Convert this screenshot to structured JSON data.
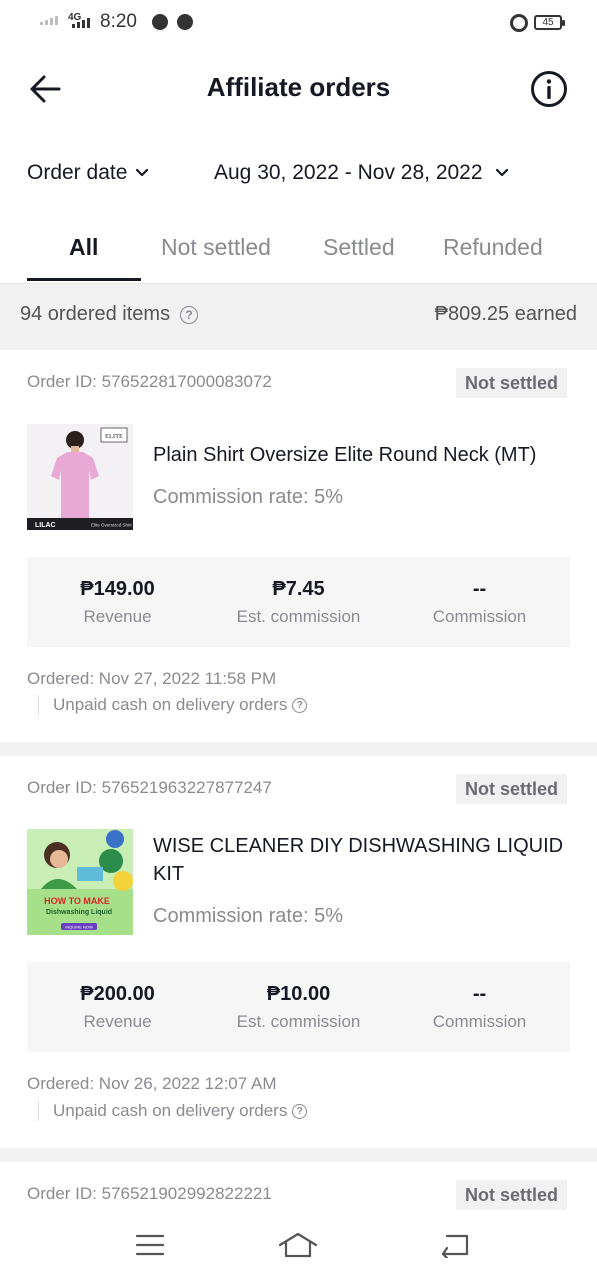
{
  "status_bar": {
    "network": "4G",
    "time": "8:20",
    "battery": "45"
  },
  "header": {
    "title": "Affiliate orders"
  },
  "filters": {
    "order_date_label": "Order date",
    "date_range": "Aug 30, 2022 - Nov 28, 2022"
  },
  "tabs": [
    {
      "label": "All",
      "active": true
    },
    {
      "label": "Not settled",
      "active": false
    },
    {
      "label": "Settled",
      "active": false
    },
    {
      "label": "Refunded",
      "active": false
    }
  ],
  "summary": {
    "ordered_items": "94 ordered items",
    "earned": "₱809.25 earned"
  },
  "orders": [
    {
      "order_id": "Order ID: 576522817000083072",
      "status": "Not settled",
      "product_name": "Plain Shirt Oversize Elite Round Neck (MT)",
      "thumbnail_text": {
        "brand": "ELITE",
        "color": "LILAC",
        "caption": "Elite Oversized Shirt"
      },
      "commission_rate": "Commission rate: 5%",
      "revenue": "₱149.00",
      "revenue_label": "Revenue",
      "est_commission": "₱7.45",
      "est_commission_label": "Est. commission",
      "commission": "--",
      "commission_label": "Commission",
      "ordered": "Ordered: Nov 27, 2022 11:58 PM",
      "payment_note": "Unpaid cash on delivery orders"
    },
    {
      "order_id": "Order ID: 576521963227877247",
      "status": "Not settled",
      "product_name": "WISE CLEANER DIY DISHWASHING LIQUID KIT",
      "thumbnail_text": {
        "headline": "HOW TO MAKE",
        "subline": "Dishwashing Liquid",
        "tag": "INQUIRE NOW"
      },
      "commission_rate": "Commission rate: 5%",
      "revenue": "₱200.00",
      "revenue_label": "Revenue",
      "est_commission": "₱10.00",
      "est_commission_label": "Est. commission",
      "commission": "--",
      "commission_label": "Commission",
      "ordered": "Ordered: Nov 26, 2022 12:07 AM",
      "payment_note": "Unpaid cash on delivery orders"
    },
    {
      "order_id": "Order ID: 576521902992822221",
      "status": "Not settled"
    }
  ],
  "colors": {
    "text_primary": "#161823",
    "text_secondary": "#8a8b91",
    "badge_bg": "#f1f1f2",
    "stats_bg": "#f6f6f7"
  }
}
